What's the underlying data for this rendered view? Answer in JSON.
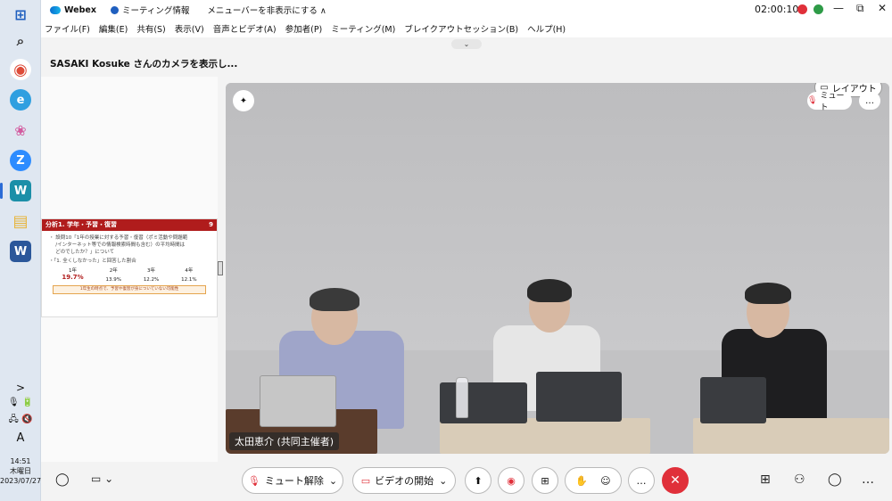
{
  "taskbar": {
    "icons": [
      {
        "name": "windows-start-icon",
        "glyph": "⊞",
        "color": "#1f5fbf"
      },
      {
        "name": "search-icon",
        "glyph": "⌕",
        "color": "#333"
      },
      {
        "name": "chrome-icon",
        "glyph": "◉",
        "color": "#dd4b39"
      },
      {
        "name": "edge-icon",
        "glyph": "e",
        "color": "#2f9fe0"
      },
      {
        "name": "paint-icon",
        "glyph": "❀",
        "color": "#d35b9f"
      },
      {
        "name": "zoom-icon",
        "glyph": "Z",
        "color": "#2d8cff"
      },
      {
        "name": "webex-icon",
        "glyph": "W",
        "color": "#1b8fa8"
      },
      {
        "name": "file-explorer-icon",
        "glyph": "▤",
        "color": "#e7b43a"
      },
      {
        "name": "word-icon",
        "glyph": "W",
        "color": "#2b579a"
      }
    ],
    "tray": {
      "expand": ">",
      "mic": "🎙",
      "keyboard_lang": "A"
    },
    "clock": {
      "time": "14:51",
      "day": "木曜日",
      "date": "2023/07/27"
    }
  },
  "titlebar": {
    "app_name": "Webex",
    "meeting_info": "ミーティング情報",
    "hide_menu": "メニューバーを非表示にする ∧",
    "timer": "02:00:10",
    "minimize": "—",
    "restore": "⧉",
    "close": "✕"
  },
  "menubar": {
    "items": [
      "ファイル(F)",
      "編集(E)",
      "共有(S)",
      "表示(V)",
      "音声とビデオ(A)",
      "参加者(P)",
      "ミーティング(M)",
      "ブレイクアウトセッション(B)",
      "ヘルプ(H)"
    ]
  },
  "collapse_chevron": "⌄",
  "sharing_label": "SASAKI Kosuke さんのカメラを表示し...",
  "slide": {
    "title": "分析1. 学年・予習・復習",
    "page": "9",
    "bullet1": "・ 設問10「1年の授業に対する予習・復習（ポミ活動や問題範",
    "bullet1b": "　 /インターネット等での情報検索時間も含む）の平均時間は",
    "bullet1c": "　 どのでしたか？」について",
    "bullet2": "・「1. 全くしなかった」と回答した割合",
    "columns": [
      {
        "label": "1年",
        "value": "19.7%",
        "highlight": true
      },
      {
        "label": "2年",
        "value": "13.9%",
        "highlight": false
      },
      {
        "label": "3年",
        "value": "12.2%",
        "highlight": false
      },
      {
        "label": "4年",
        "value": "12.1%",
        "highlight": false
      }
    ],
    "note": "1年生の時点で、予習や復習が身についていない可能性"
  },
  "video": {
    "layout_button": "レイアウト",
    "mute_badge": "ミュート",
    "more_button": "…",
    "pin_icon": "✦",
    "name_tag": "太田恵介 (共同主催者)"
  },
  "controls": {
    "unmute": "ミュート解除",
    "start_video": "ビデオの開始",
    "dropdown": "⌄",
    "share": "⬆",
    "record": "◉",
    "apps": "⊞",
    "raise_hand": "✋",
    "reactions": "☺",
    "more": "…",
    "end": "✕",
    "participants": "⚇",
    "chat": "◯"
  },
  "colors": {
    "accent_red": "#e0303a",
    "brand_blue": "#1f5fbf"
  }
}
